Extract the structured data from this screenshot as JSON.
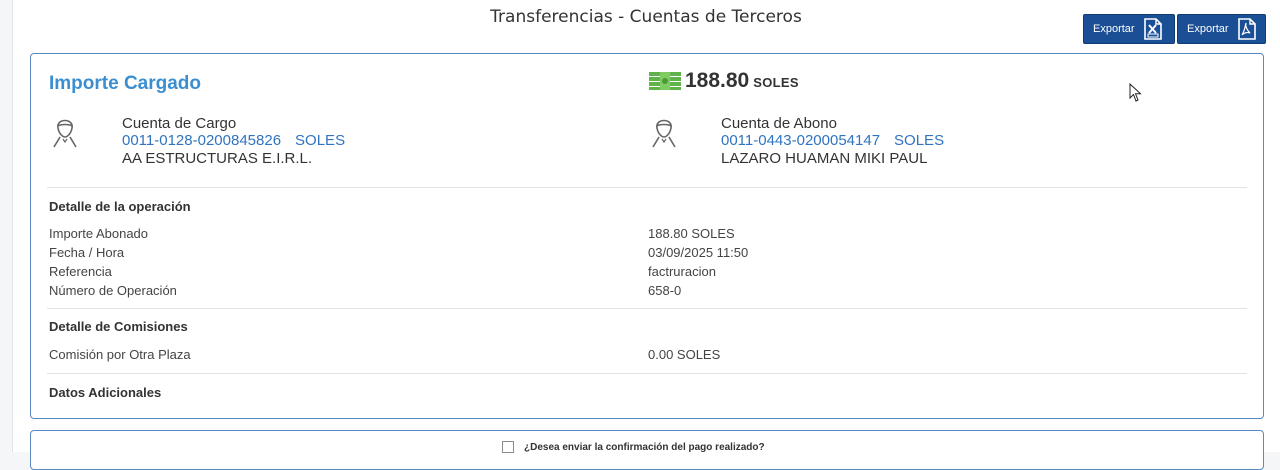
{
  "header": {
    "title": "Transferencias - Cuentas de Terceros",
    "export_excel_label": "Exportar",
    "export_pdf_label": "Exportar"
  },
  "summary": {
    "title": "Importe Cargado",
    "amount": "188.80",
    "currency": "SOLES"
  },
  "cargo": {
    "label": "Cuenta de Cargo",
    "account": "0011-0128-0200845826",
    "currency": "SOLES",
    "holder": "AA ESTRUCTURAS E.I.R.L."
  },
  "abono": {
    "label": "Cuenta de Abono",
    "account": "0011-0443-0200054147",
    "currency": "SOLES",
    "holder": "LAZARO HUAMAN MIKI PAUL"
  },
  "operacion": {
    "heading": "Detalle de la operación",
    "rows": [
      {
        "label": "Importe Abonado",
        "value": "188.80  SOLES"
      },
      {
        "label": "Fecha / Hora",
        "value": "03/09/2025  11:50"
      },
      {
        "label": "Referencia",
        "value": "factruracion"
      },
      {
        "label": "Número de Operación",
        "value": "658-0"
      }
    ]
  },
  "comisiones": {
    "heading": "Detalle de Comisiones",
    "rows": [
      {
        "label": "Comisión por Otra Plaza",
        "value": "0.00  SOLES"
      }
    ]
  },
  "adicionales": {
    "heading": "Datos Adicionales"
  },
  "confirmation": {
    "label": "¿Desea enviar la confirmación del pago realizado?",
    "checked": false
  },
  "colors": {
    "accent": "#3b8fd1",
    "link": "#2f74c0",
    "button": "#1a4f95",
    "money_icon": "#5fb34a"
  }
}
